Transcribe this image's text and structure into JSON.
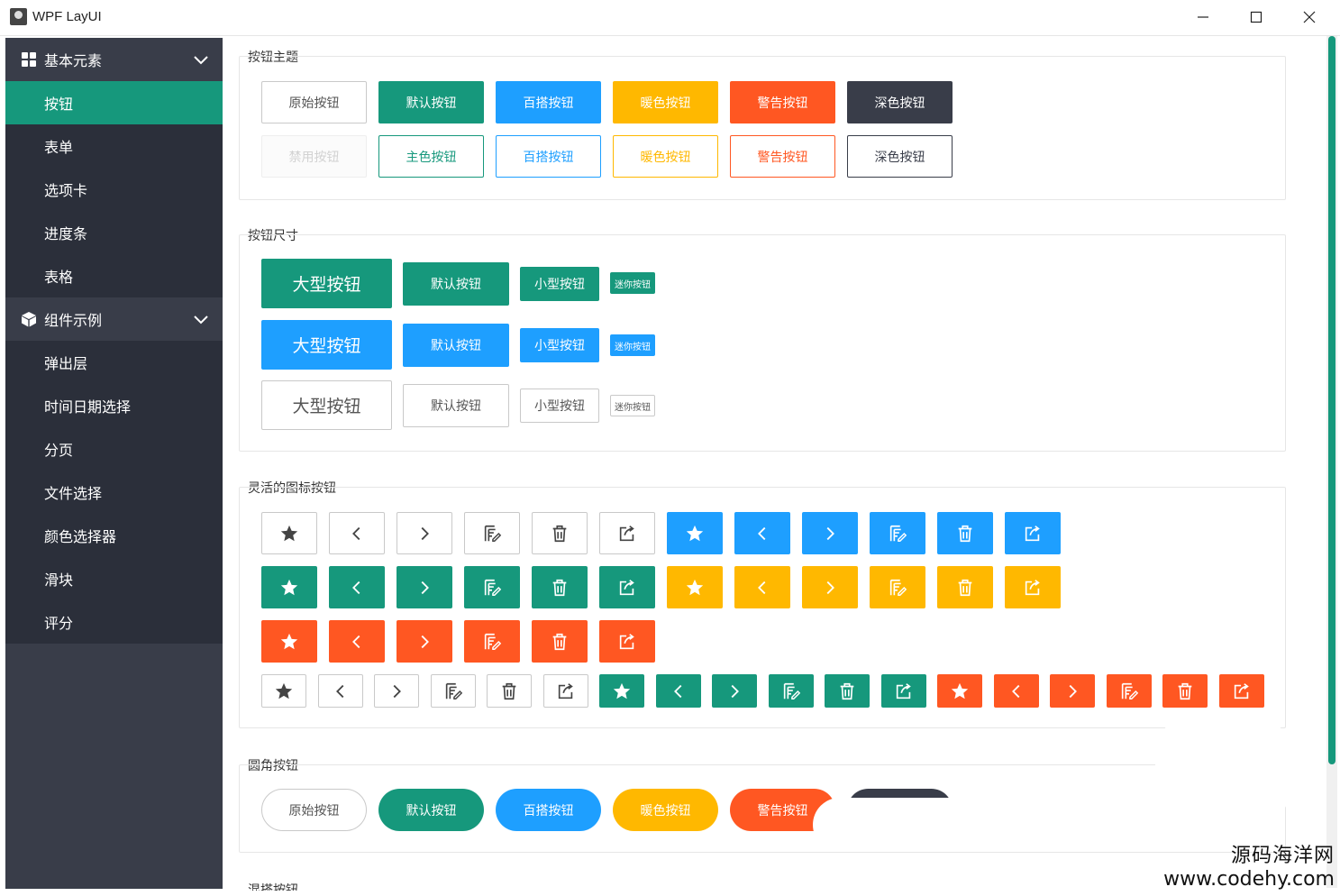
{
  "window": {
    "title": "WPF LayUI",
    "minimize": "—",
    "maximize": "☐",
    "close": "✕"
  },
  "sidebar": {
    "groups": [
      {
        "label": "基本元素",
        "icon": "grid-icon",
        "items": [
          "按钮",
          "表单",
          "选项卡",
          "进度条",
          "表格"
        ]
      },
      {
        "label": "组件示例",
        "icon": "cube-icon",
        "items": [
          "弹出层",
          "时间日期选择",
          "分页",
          "文件选择",
          "颜色选择器",
          "滑块",
          "评分"
        ]
      }
    ],
    "active_item": "按钮"
  },
  "sections": {
    "theme": {
      "title": "按钮主题",
      "row1": [
        "原始按钮",
        "默认按钮",
        "百搭按钮",
        "暖色按钮",
        "警告按钮",
        "深色按钮"
      ],
      "row2": [
        "禁用按钮",
        "主色按钮",
        "百搭按钮",
        "暖色按钮",
        "警告按钮",
        "深色按钮"
      ]
    },
    "size": {
      "title": "按钮尺寸",
      "labels": [
        "大型按钮",
        "默认按钮",
        "小型按钮",
        "迷你按钮"
      ]
    },
    "icon": {
      "title": "灵活的图标按钮",
      "icons": [
        "star-icon",
        "chevron-left-icon",
        "chevron-right-icon",
        "edit-icon",
        "trash-icon",
        "share-icon"
      ]
    },
    "round": {
      "title": "圆角按钮",
      "labels": [
        "原始按钮",
        "默认按钮",
        "百搭按钮",
        "暖色按钮",
        "警告按钮"
      ]
    },
    "mixed": {
      "title": "混搭按钮"
    }
  },
  "colors": {
    "default": "#16987c",
    "normal": "#1e9fff",
    "warm": "#ffb800",
    "danger": "#ff5722",
    "dark": "#393d49"
  },
  "watermark": {
    "line1": "源码海洋网",
    "line2": "www.codehy.com"
  }
}
